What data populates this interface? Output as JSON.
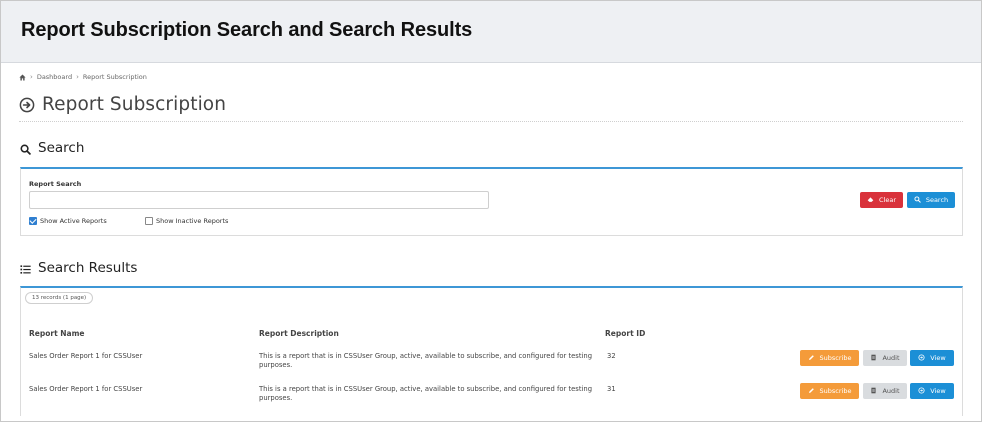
{
  "doc": {
    "title": "Report Subscription Search and Search Results"
  },
  "breadcrumb": {
    "items": [
      "Dashboard",
      "Report Subscription"
    ]
  },
  "page": {
    "title": "Report Subscription"
  },
  "search": {
    "section_title": "Search",
    "field_label": "Report Search",
    "input_value": "",
    "show_active_label": "Show Active Reports",
    "show_active_checked": true,
    "show_inactive_label": "Show Inactive Reports",
    "show_inactive_checked": false,
    "clear_label": "Clear",
    "search_label": "Search"
  },
  "results": {
    "section_title": "Search Results",
    "records_count": "13 records (1 page)",
    "columns": [
      "Report Name",
      "Report Description",
      "Report ID"
    ],
    "rows": [
      {
        "name": "Sales Order Report 1 for CSSUser",
        "description": "This is a report that is in CSSUser Group, active, available to subscribe, and configured for testing purposes.",
        "id": "32"
      },
      {
        "name": "Sales Order Report 1 for CSSUser",
        "description": "This is a report that is in CSSUser Group, active, available to subscribe, and configured for testing purposes.",
        "id": "31"
      }
    ],
    "actions": {
      "subscribe_label": "Subscribe",
      "audit_label": "Audit",
      "view_label": "View"
    }
  },
  "colors": {
    "accent": "#3d97d6",
    "clear_button": "#d9323b",
    "primary_button": "#1c8fd6",
    "subscribe_button": "#f49b3a",
    "audit_button": "#d9dcdf"
  },
  "icons": [
    "home-icon",
    "arrow-circle-right-icon",
    "search-icon",
    "list-icon",
    "eraser-icon",
    "pencil-icon",
    "document-icon",
    "eye-icon"
  ]
}
